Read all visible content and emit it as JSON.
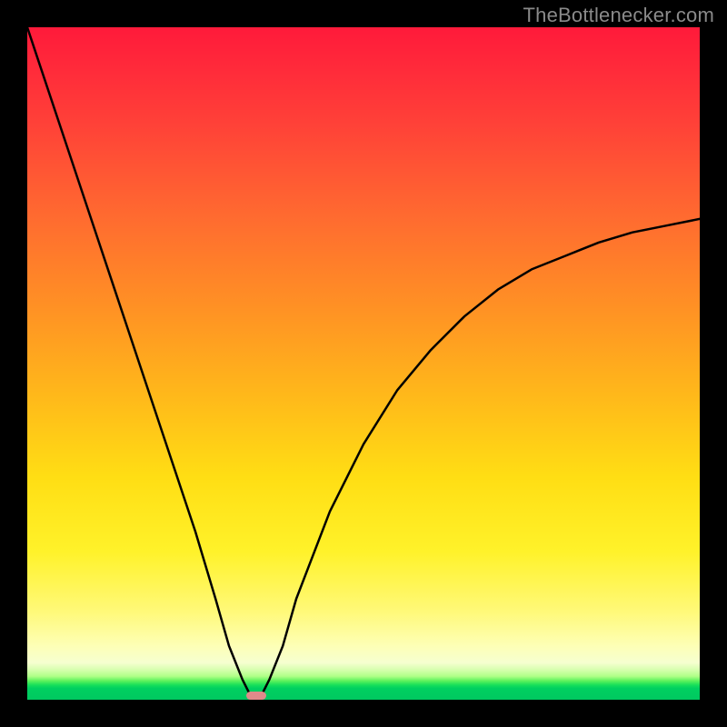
{
  "watermark": {
    "text": "TheBottlenecker.com"
  },
  "colors": {
    "frame": "#000000",
    "curve": "#000000",
    "marker": "#e08a8a",
    "gradient_top": "#ff1a3a",
    "gradient_bottom": "#00c860"
  },
  "chart_data": {
    "type": "line",
    "title": "",
    "xlabel": "",
    "ylabel": "",
    "xlim": [
      0,
      100
    ],
    "ylim": [
      0,
      100
    ],
    "series": [
      {
        "name": "bottleneck-curve",
        "x": [
          0,
          5,
          10,
          15,
          20,
          25,
          28,
          30,
          32,
          33,
          34,
          35,
          36,
          38,
          40,
          45,
          50,
          55,
          60,
          65,
          70,
          75,
          80,
          85,
          90,
          95,
          100
        ],
        "values": [
          100,
          85,
          70,
          55,
          40,
          25,
          15,
          8,
          3,
          1,
          0,
          1,
          3,
          8,
          15,
          28,
          38,
          46,
          52,
          57,
          61,
          64,
          66,
          68,
          69.5,
          70.5,
          71.5
        ]
      }
    ],
    "marker": {
      "x": 34,
      "y": 0,
      "w": 3,
      "h": 1.2
    },
    "annotations": []
  }
}
